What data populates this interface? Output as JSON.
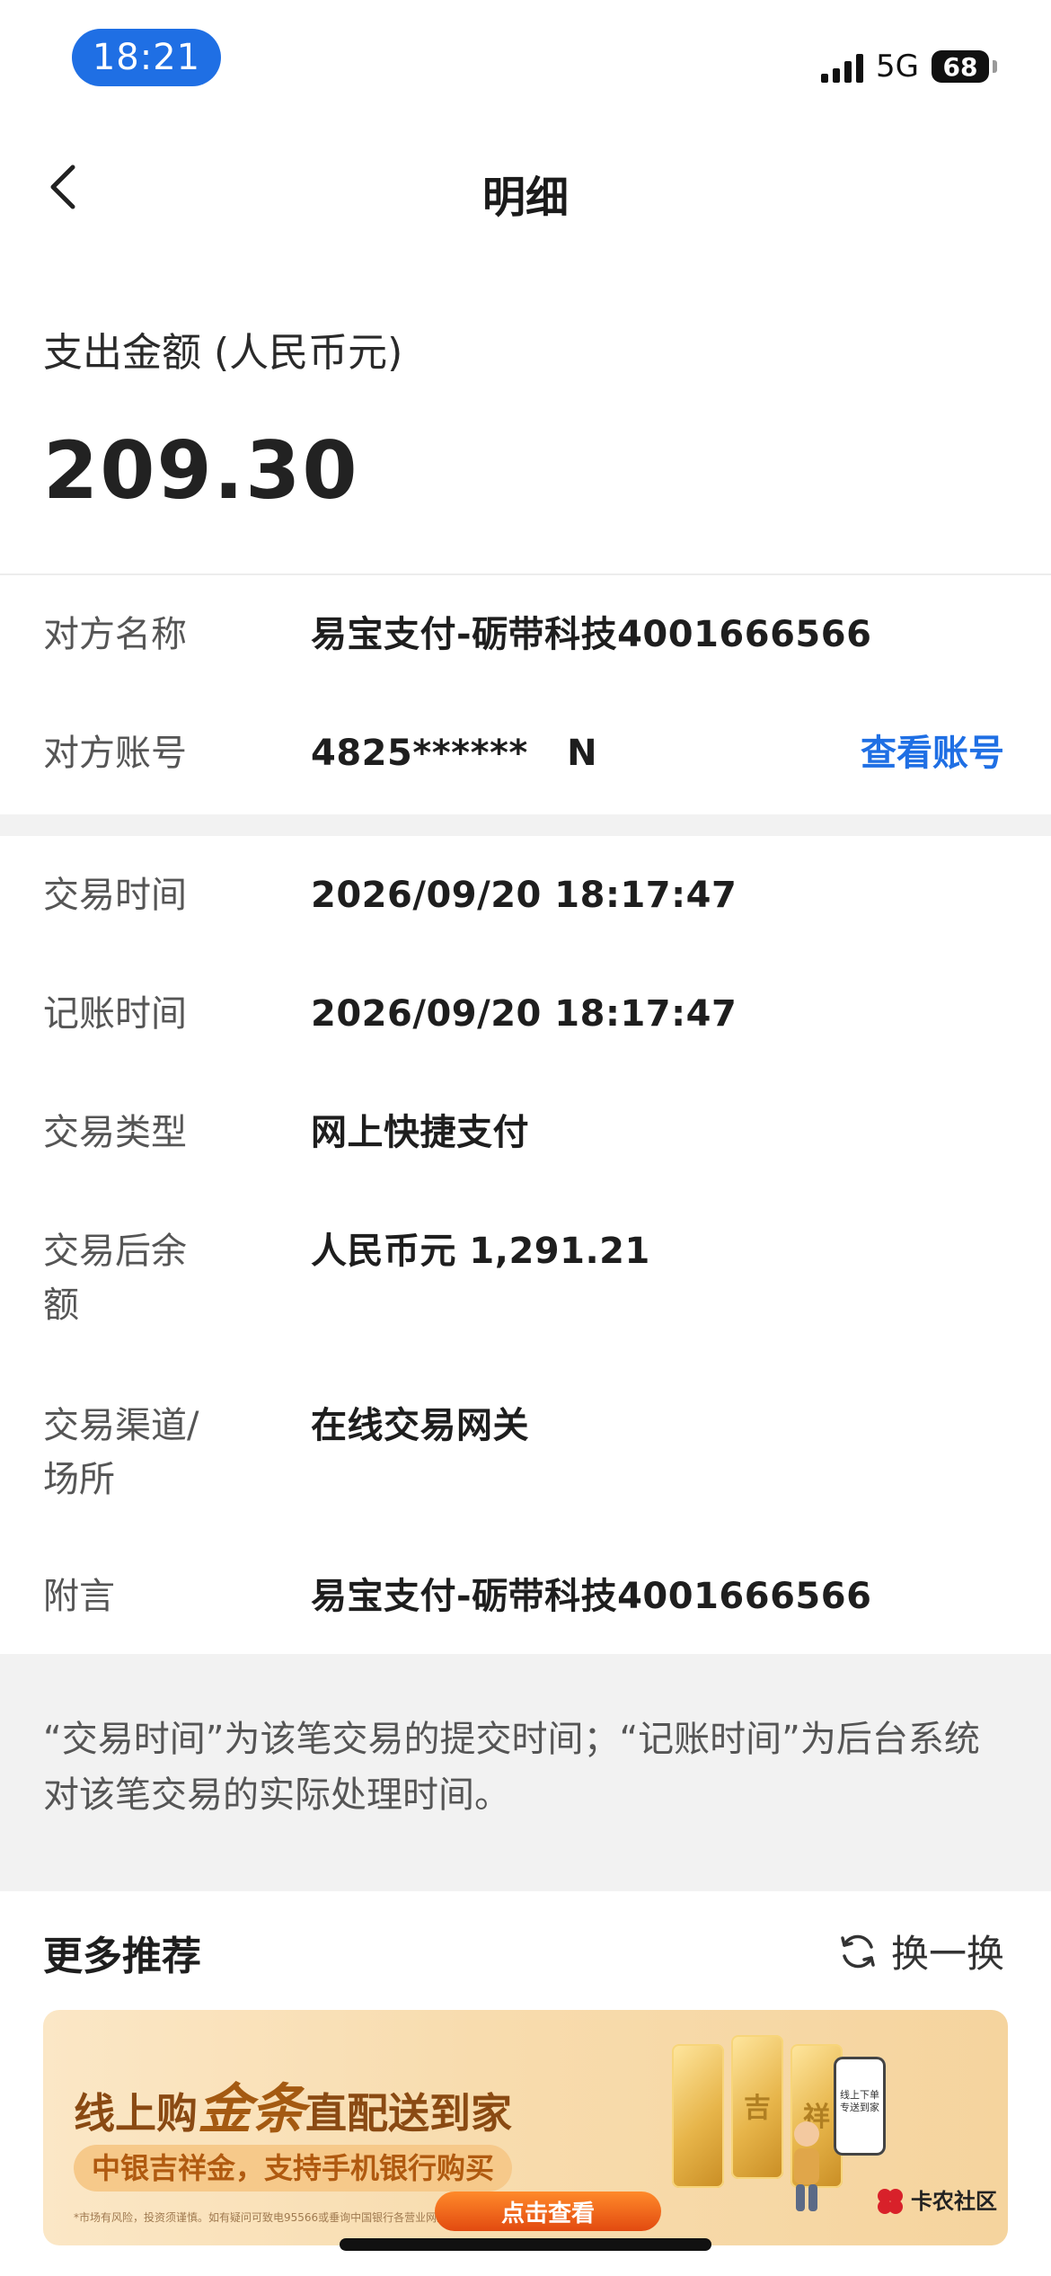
{
  "status_bar": {
    "time": "18:21",
    "network": "5G",
    "battery": "68"
  },
  "nav": {
    "title": "明细"
  },
  "amount": {
    "label": "支出金额 (人民币元)",
    "value": "209.30"
  },
  "counterparty": {
    "name_label": "对方名称",
    "name_value": "易宝支付-砺带科技4001666566",
    "account_label": "对方账号",
    "account_value": "4825******   N",
    "view_account_label": "查看账号"
  },
  "details": [
    {
      "label": "交易时间",
      "value": "2026/09/20 18:17:47"
    },
    {
      "label": "记账时间",
      "value": "2026/09/20 18:17:47"
    },
    {
      "label": "交易类型",
      "value": "网上快捷支付"
    },
    {
      "label": "交易后余额",
      "value": "人民币元 1,291.21"
    },
    {
      "label": "交易渠道/场所",
      "value": "在线交易网关"
    },
    {
      "label": "附言",
      "value": "易宝支付-砺带科技4001666566"
    }
  ],
  "note": "“交易时间”为该笔交易的提交时间；“记账时间”为后台系统对该笔交易的实际处理时间。",
  "recommend": {
    "title": "更多推荐",
    "refresh_label": "换一换",
    "banner": {
      "head_prefix": "线上购",
      "head_gold": "金条",
      "head_suffix": "直配送到家",
      "subtitle": "中银吉祥金，支持手机银行购买",
      "fine_print": "*市场有风险，投资须谨慎。如有疑问可致电95566或垂询中国银行各营业网点。",
      "button": "点击查看",
      "bar_chars": [
        "",
        "吉",
        "祥"
      ],
      "phone_text": "线上下单专送到家",
      "logo_text": "卡农社区"
    }
  },
  "colors": {
    "accent": "#1f6fe4",
    "banner_button": "#e24a10"
  }
}
